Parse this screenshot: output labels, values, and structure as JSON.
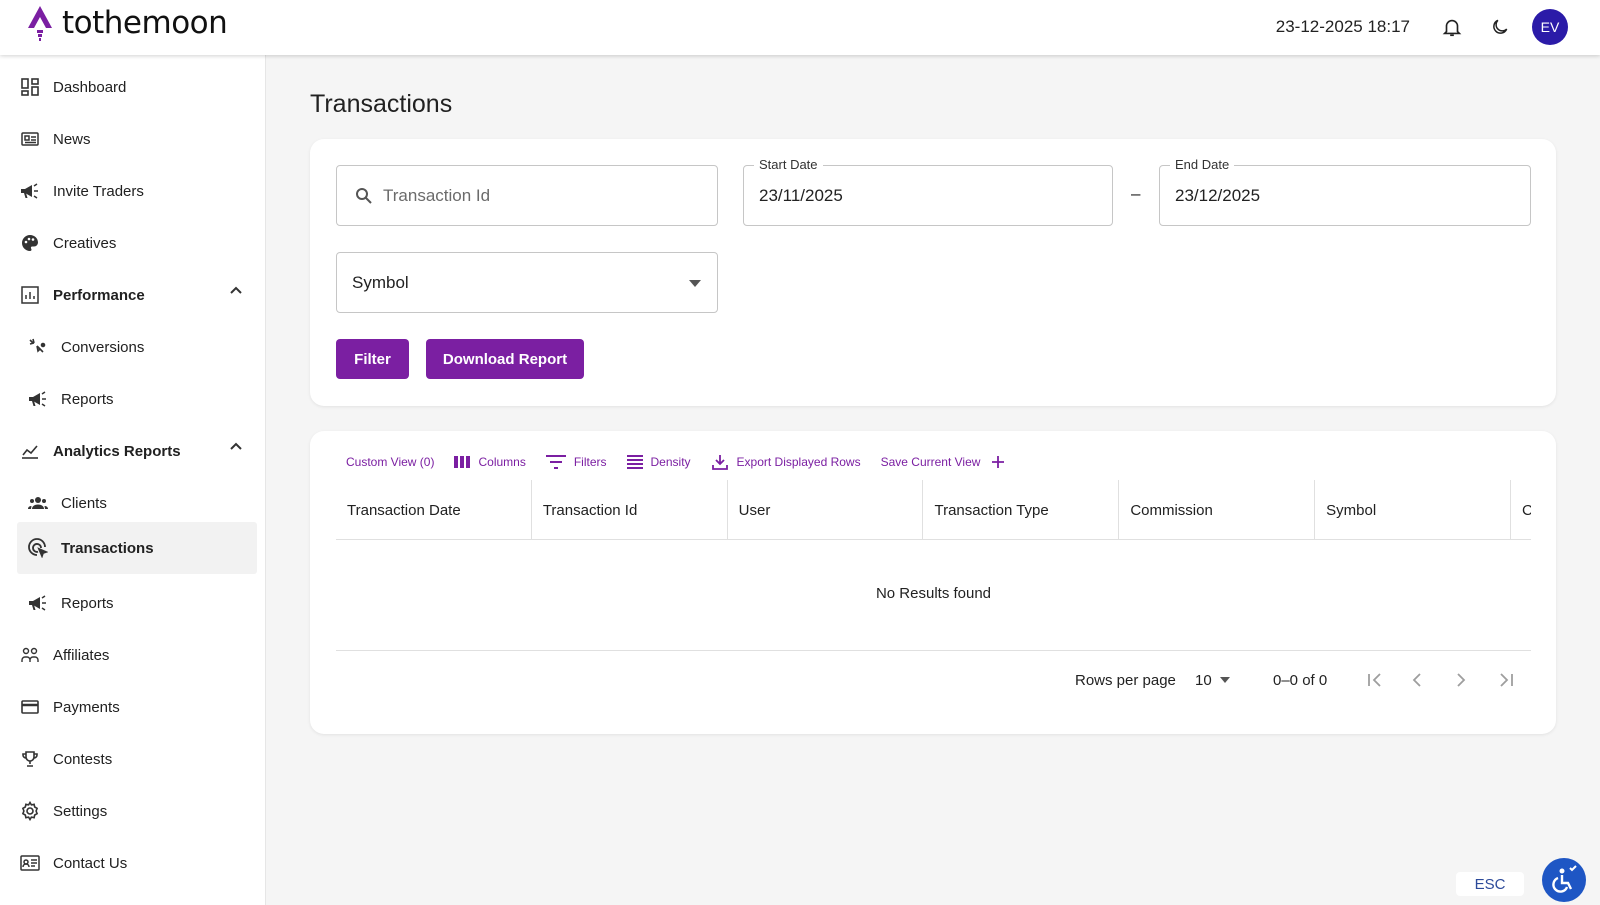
{
  "header": {
    "brand": "tothemoon",
    "datetime": "23-12-2025 18:17",
    "avatar_initials": "EV",
    "icons": [
      "logo-icon",
      "bell-icon",
      "moon-icon"
    ]
  },
  "sidebar": {
    "items": [
      {
        "label": "Dashboard",
        "icon": "dashboard-icon"
      },
      {
        "label": "News",
        "icon": "news-icon"
      },
      {
        "label": "Invite Traders",
        "icon": "megaphone-icon"
      },
      {
        "label": "Creatives",
        "icon": "palette-icon"
      },
      {
        "label": "Performance",
        "icon": "chart-box-icon",
        "expanded": true
      },
      {
        "label": "Conversions",
        "icon": "conversions-icon"
      },
      {
        "label": "Reports",
        "icon": "megaphone-icon"
      },
      {
        "label": "Analytics Reports",
        "icon": "line-chart-icon",
        "expanded": true
      },
      {
        "label": "Clients",
        "icon": "clients-icon"
      },
      {
        "label": "Transactions",
        "icon": "transactions-icon",
        "active": true
      },
      {
        "label": "Reports",
        "icon": "megaphone-icon"
      },
      {
        "label": "Affiliates",
        "icon": "affiliates-icon"
      },
      {
        "label": "Payments",
        "icon": "card-icon"
      },
      {
        "label": "Contests",
        "icon": "trophy-icon"
      },
      {
        "label": "Settings",
        "icon": "gear-icon"
      },
      {
        "label": "Contact Us",
        "icon": "contact-icon"
      }
    ]
  },
  "page": {
    "title": "Transactions"
  },
  "filters": {
    "transaction_id_placeholder": "Transaction Id",
    "start_date_label": "Start Date",
    "start_date_value": "23/11/2025",
    "date_separator": "–",
    "end_date_label": "End Date",
    "end_date_value": "23/12/2025",
    "symbol_value": "Symbol",
    "filter_button": "Filter",
    "download_button": "Download Report"
  },
  "grid": {
    "toolbar": {
      "custom_view": "Custom View (0)",
      "columns": "Columns",
      "filters": "Filters",
      "density": "Density",
      "export": "Export Displayed Rows",
      "save_view": "Save Current View"
    },
    "columns": [
      "Transaction Date",
      "Transaction Id",
      "User",
      "Transaction Type",
      "Commission",
      "Symbol",
      "C"
    ],
    "empty_message": "No Results found",
    "rows_per_page_label": "Rows per page",
    "rows_per_page_value": "10",
    "range_text": "0–0 of 0"
  },
  "footer": {
    "esc_label": "ESC"
  },
  "colors": {
    "accent": "#7b1fa2",
    "avatar_bg": "#2b1ba8",
    "a11y_bg": "#1e56c4"
  }
}
